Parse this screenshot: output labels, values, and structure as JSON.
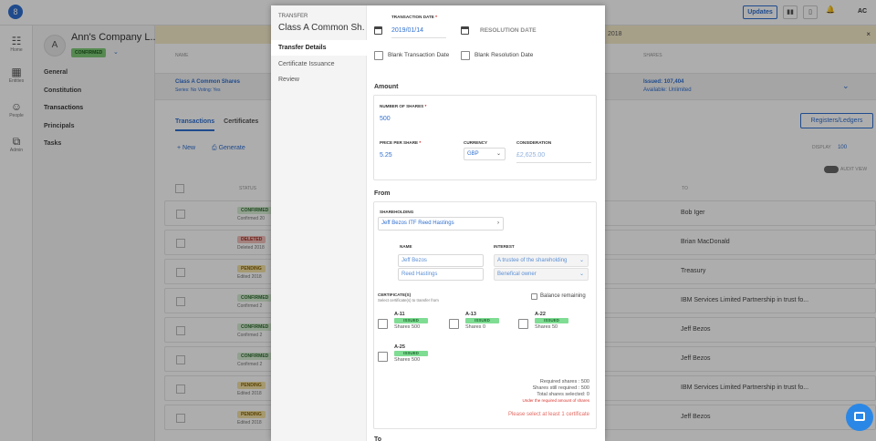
{
  "topbar": {
    "logo": "8",
    "updates_label": "Updates",
    "icons": [
      "book-icon",
      "document-icon",
      "bell-icon"
    ],
    "user_initials": "AC"
  },
  "rail": {
    "items": [
      {
        "icon": "home-icon",
        "glyph": "☷",
        "label": "Home"
      },
      {
        "icon": "entities-icon",
        "glyph": "▦",
        "label": "Entities"
      },
      {
        "icon": "people-icon",
        "glyph": "☺",
        "label": "People"
      },
      {
        "icon": "admin-icon",
        "glyph": "⧉",
        "label": "Admin"
      }
    ]
  },
  "left_nav": {
    "avatar_letter": "A",
    "company_name": "Ann's Company L...",
    "company_status": "CONFIRMED",
    "links": [
      "General",
      "Constitution",
      "Transactions",
      "Principals",
      "Tasks"
    ],
    "active_link": "Transactions"
  },
  "notice": {
    "text": "2018",
    "close": "×"
  },
  "share_row": {
    "name_label": "NAME",
    "shares_label": "SHARES",
    "class_name": "Class A Common Shares",
    "class_sub": "Series: No  Voting: Yes",
    "issued": "Issued: 107,404",
    "available": "Available: Unlimited"
  },
  "main": {
    "tabs": [
      "Transactions",
      "Certificates"
    ],
    "new_label": "+ New",
    "generate_label": "Generate",
    "registers_label": "Registers/Ledgers",
    "display_label": "DISPLAY",
    "display_value": "100",
    "audit_label": "AUDIT VIEW",
    "header_status": "STATUS",
    "header_to": "TO",
    "rows": [
      {
        "status": "CONFIRMED",
        "kind": "confirmed",
        "sub": "Confirmed 20",
        "to": "Bob Iger"
      },
      {
        "status": "DELETED",
        "kind": "deleted",
        "sub": "Deleted 2018",
        "to": "Brian MacDonald"
      },
      {
        "status": "PENDING",
        "kind": "pending",
        "sub": "Edited 2018",
        "to": "Treasury"
      },
      {
        "status": "CONFIRMED",
        "kind": "confirmed",
        "sub": "Confirmed 2",
        "to": "IBM Services Limited Partnership in trust fo..."
      },
      {
        "status": "CONFIRMED",
        "kind": "confirmed",
        "sub": "Confirmed 2",
        "to": "Jeff Bezos"
      },
      {
        "status": "CONFIRMED",
        "kind": "confirmed",
        "sub": "Confirmed 2",
        "to": "Jeff Bezos"
      },
      {
        "status": "PENDING",
        "kind": "pending",
        "sub": "Edited 2018",
        "to": "IBM Services Limited Partnership in trust fo..."
      },
      {
        "status": "PENDING",
        "kind": "pending",
        "sub": "Edited 2018",
        "to": "Jeff Bezos"
      }
    ]
  },
  "modal": {
    "eyebrow": "TRANSFER",
    "title": "Class A Common Sh...",
    "steps": [
      "Transfer Details",
      "Certificate Issuance",
      "Review"
    ],
    "active_step": "Transfer Details",
    "transaction_date_label": "TRANSACTION DATE",
    "transaction_date": "2019/01/14",
    "resolution_date_label": "RESOLUTION DATE",
    "blank_transaction_date": "Blank Transaction Date",
    "blank_resolution_date": "Blank Resolution Date",
    "amount": {
      "title": "Amount",
      "shares_label": "NUMBER OF SHARES",
      "shares": "500",
      "price_label": "PRICE PER SHARE",
      "price": "5.25",
      "currency_label": "CURRENCY",
      "currency": "GBP",
      "consideration_label": "CONSIDERATION",
      "consideration": "£2,625.00"
    },
    "from": {
      "title": "From",
      "shareholding_label": "SHAREHOLDING",
      "shareholding": "Jeff Bezos ITF Reed Hastings",
      "name_header": "NAME",
      "interest_header": "INTEREST",
      "holders": [
        {
          "name": "Jeff Bezos",
          "interest": "A trustee of the shareholding"
        },
        {
          "name": "Reed Hastings",
          "interest": "Benefical owner"
        }
      ],
      "certificates_label": "CERTIFICATE(S)",
      "certificates_hint": "Select certificate(s) to transfer from",
      "balance_remaining": "Balance remaining",
      "certificates": [
        {
          "id": "A-11",
          "status": "ISSUED",
          "shares": "Shares 500"
        },
        {
          "id": "A-13",
          "status": "ISSUED",
          "shares": "Shares 0"
        },
        {
          "id": "A-22",
          "status": "ISSUED",
          "shares": "Shares 50"
        },
        {
          "id": "A-25",
          "status": "ISSUED",
          "shares": "Shares 500"
        }
      ],
      "required_shares": "Required shares : 500",
      "still_required": "Shares still required : 500",
      "total_selected": "Total shares selected: 0",
      "under_required": "Under the required amount of shares",
      "error": "Please select at least 1 certificate"
    },
    "to_title": "To"
  }
}
